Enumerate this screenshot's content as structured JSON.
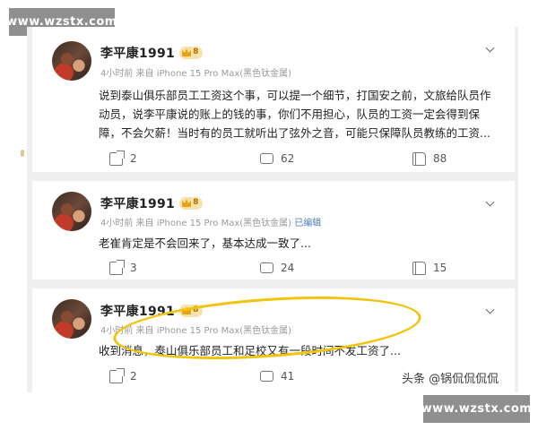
{
  "watermark": "www.wzstx.com",
  "author_tag": "头条 @锅侃侃侃侃",
  "posts": [
    {
      "username": "李平康1991",
      "vip_level": "8",
      "meta": "4小时前 来自 iPhone 15 Pro Max(黑色钛金属)",
      "edited": "",
      "text": "说到泰山俱乐部员工工资这个事，可以提一个细节，打国安之前，文旅给队员作动员，说李平康说的账上的钱的事，你们不用担心，队员的工资一定会得到保障，不会欠薪！当时有的员工就听出了弦外之音，可能只保障队员教练的工资...",
      "reposts": "2",
      "comments": "62",
      "likes": "88"
    },
    {
      "username": "李平康1991",
      "vip_level": "8",
      "meta": "4小时前 来自 iPhone 15 Pro Max(黑色钛金属)",
      "edited": "已编辑",
      "text": "老崔肯定是不会回来了，基本达成一致了...",
      "reposts": "3",
      "comments": "24",
      "likes": "15"
    },
    {
      "username": "李平康1991",
      "vip_level": "8",
      "meta": "4小时前 来自 iPhone 15 Pro Max(黑色钛金属)",
      "edited": "",
      "text": "收到消息，泰山俱乐部员工和足校又有一段时间不发工资了...",
      "reposts": "2",
      "comments": "41",
      "likes": ""
    }
  ],
  "colors": {
    "highlight": "#f1c40f",
    "vip_badge": "#f7e3a9",
    "edited_link": "#4a7cb8"
  }
}
